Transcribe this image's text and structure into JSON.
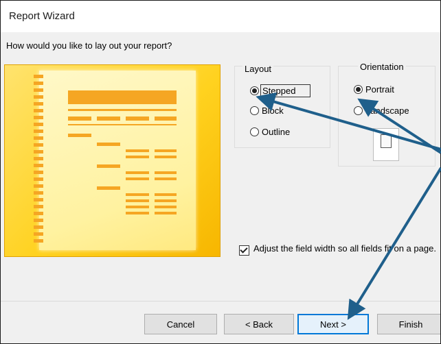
{
  "window": {
    "title": "Report Wizard"
  },
  "wizard": {
    "question": "How would you like to lay out your report?"
  },
  "layout": {
    "label": "Layout",
    "options": [
      {
        "label": "Stepped",
        "selected": true
      },
      {
        "label": "Block",
        "selected": false
      },
      {
        "label": "Outline",
        "selected": false
      }
    ]
  },
  "orientation": {
    "label": "Orientation",
    "options": [
      {
        "label": "Portrait",
        "selected": true
      },
      {
        "label": "Landscape",
        "selected": false
      }
    ]
  },
  "adjust_width": {
    "label": "Adjust the field width so all fields fit on a page.",
    "checked": true
  },
  "buttons": {
    "cancel": "Cancel",
    "back": "< Back",
    "next": "Next >",
    "finish": "Finish"
  },
  "colors": {
    "arrow": "#1f5f8b",
    "preview_accent": "#f5a623",
    "default_button": "#0078d7"
  }
}
